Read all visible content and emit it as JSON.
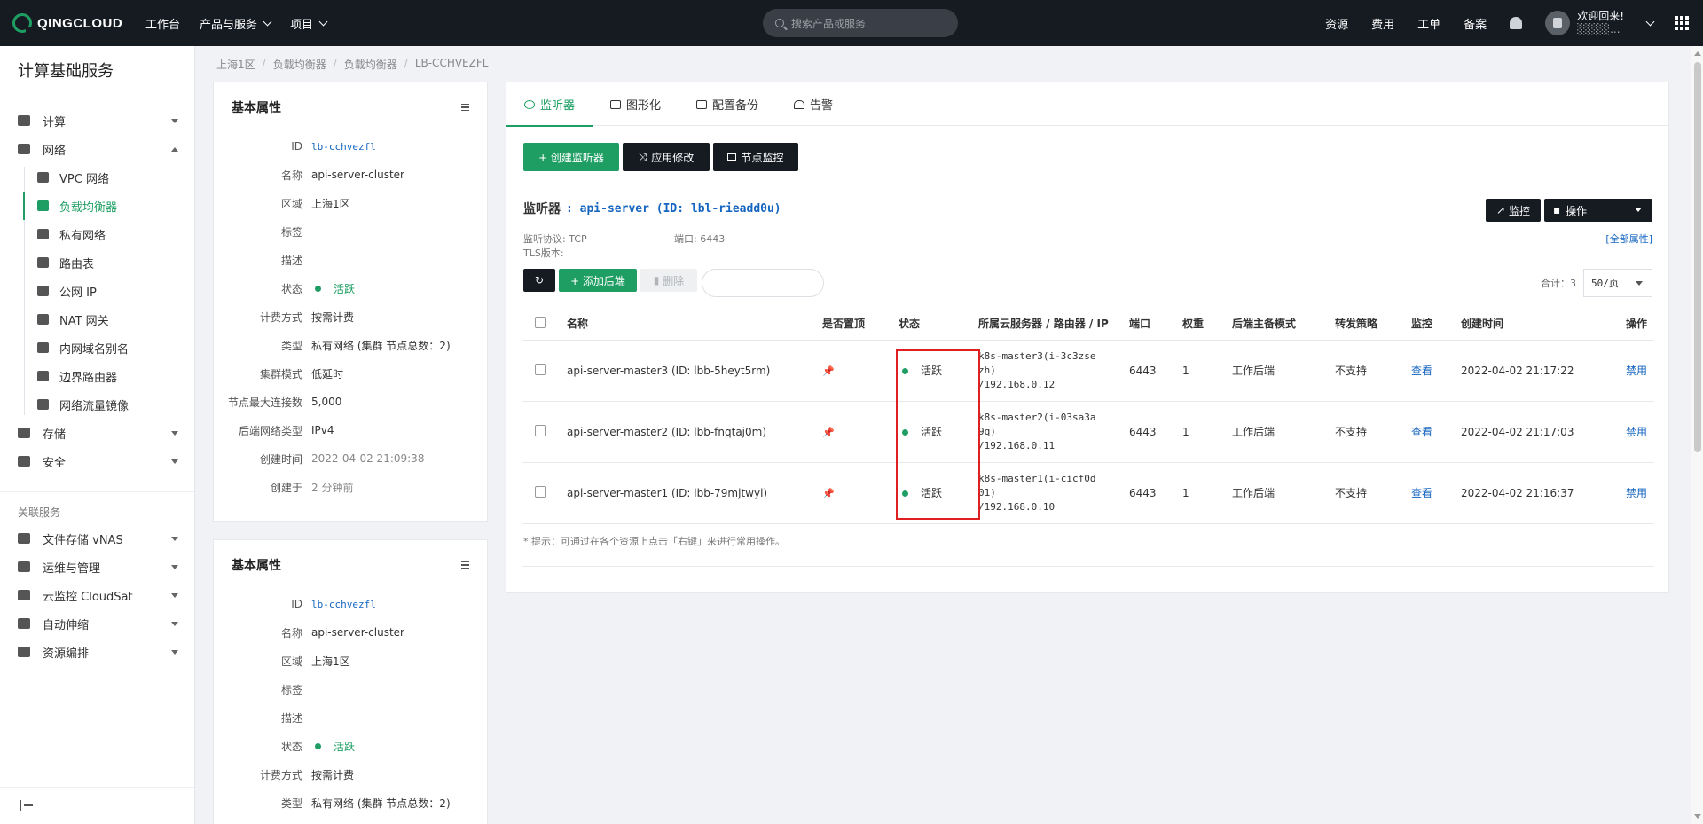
{
  "topbar": {
    "logo": "QINGCLOUD",
    "nav": [
      "工作台",
      "产品与服务",
      "项目"
    ],
    "search_placeholder": "搜索产品或服务",
    "right_items": [
      "资源",
      "费用",
      "工单",
      "备案"
    ],
    "welcome": "欢迎回来!",
    "welcome_sub": "░░░░..."
  },
  "sidebar": {
    "title": "计算基础服务",
    "groups": [
      {
        "label": "计算",
        "icon": "chip-icon"
      },
      {
        "label": "网络",
        "icon": "network-icon"
      }
    ],
    "network_items": [
      {
        "label": "VPC 网络",
        "icon": "vpc-icon"
      },
      {
        "label": "负载均衡器",
        "icon": "load-balancer-icon",
        "active": true
      },
      {
        "label": "私有网络",
        "icon": "wifi-icon"
      },
      {
        "label": "路由表",
        "icon": "route-table-icon"
      },
      {
        "label": "公网 IP",
        "icon": "public-ip-icon"
      },
      {
        "label": "NAT 网关",
        "icon": "nat-gateway-icon"
      },
      {
        "label": "内网域名别名",
        "icon": "dns-alias-icon"
      },
      {
        "label": "边界路由器",
        "icon": "border-router-icon"
      },
      {
        "label": "网络流量镜像",
        "icon": "traffic-mirror-icon"
      }
    ],
    "groups2": [
      {
        "label": "存储",
        "icon": "storage-icon"
      },
      {
        "label": "安全",
        "icon": "shield-icon"
      }
    ],
    "related_label": "关联服务",
    "related": [
      {
        "label": "文件存储 vNAS",
        "icon": "folder-icon"
      },
      {
        "label": "运维与管理",
        "icon": "ops-icon"
      },
      {
        "label": "云监控 CloudSat",
        "icon": "monitor-icon"
      },
      {
        "label": "自动伸缩",
        "icon": "autoscale-icon"
      },
      {
        "label": "资源编排",
        "icon": "orchestration-icon"
      }
    ]
  },
  "breadcrumb": [
    "上海1区",
    "负载均衡器",
    "负载均衡器",
    "LB-CCHVEZFL"
  ],
  "props_panel": {
    "title": "基本属性",
    "rows": [
      {
        "k": "ID",
        "v": "lb-cchvezfl",
        "style": "mono"
      },
      {
        "k": "名称",
        "v": "api-server-cluster"
      },
      {
        "k": "区域",
        "v": "上海1区"
      },
      {
        "k": "标签",
        "v": ""
      },
      {
        "k": "描述",
        "v": ""
      },
      {
        "k": "状态",
        "v": "活跃",
        "style": "status"
      },
      {
        "k": "计费方式",
        "v": "按需计费"
      },
      {
        "k": "类型",
        "v": "私有网络 (集群 节点总数：2)"
      },
      {
        "k": "集群模式",
        "v": "低延时"
      },
      {
        "k": "节点最大连接数",
        "v": "5,000"
      },
      {
        "k": "后端网络类型",
        "v": "IPv4"
      },
      {
        "k": "创建时间",
        "v": "2022-04-02 21:09:38",
        "style": "gray"
      },
      {
        "k": "创建于",
        "v": "2 分钟前",
        "style": "gray"
      }
    ]
  },
  "tabs": [
    "监听器",
    "图形化",
    "配置备份",
    "告警"
  ],
  "toolbar": {
    "create": "+ 创建监听器",
    "apply": "应用修改",
    "node_monitor": "节点监控"
  },
  "listener": {
    "prefix": "监听器",
    "name": ": api-server (ID: lbl-rieadd0u)",
    "protocol_label": "监听协议: TCP",
    "port_label": "端口: 6443",
    "tls_label": "TLS版本:",
    "monitor_btn": "监控",
    "ops_btn": "操作",
    "all_props": "[全部属性]",
    "add_backend": "+ 添加后端",
    "delete": "删除",
    "total": "合计：3",
    "per_page": "50/页"
  },
  "table": {
    "headers": [
      "名称",
      "是否置顶",
      "状态",
      "所属云服务器 / 路由器 / IP",
      "端口",
      "权重",
      "后端主备模式",
      "转发策略",
      "监控",
      "创建时间",
      "操作"
    ],
    "rows": [
      {
        "name": "api-server-master3 (ID: lbb-5heyt5rm)",
        "status": "活跃",
        "srv1": "k8s-master3(i-3c3zse",
        "srv2": "zh)",
        "srv3": "/192.168.0.12",
        "port": "6443",
        "weight": "1",
        "mode": "工作后端",
        "policy": "不支持",
        "monitor": "查看",
        "created": "2022-04-02 21:17:22",
        "op": "禁用"
      },
      {
        "name": "api-server-master2 (ID: lbb-fnqtaj0m)",
        "status": "活跃",
        "srv1": "k8s-master2(i-03sa3a",
        "srv2": "9q)",
        "srv3": "/192.168.0.11",
        "port": "6443",
        "weight": "1",
        "mode": "工作后端",
        "policy": "不支持",
        "monitor": "查看",
        "created": "2022-04-02 21:17:03",
        "op": "禁用"
      },
      {
        "name": "api-server-master1 (ID: lbb-79mjtwyl)",
        "status": "活跃",
        "srv1": "k8s-master1(i-cicf0d",
        "srv2": "01)",
        "srv3": "/192.168.0.10",
        "port": "6443",
        "weight": "1",
        "mode": "工作后端",
        "policy": "不支持",
        "monitor": "查看",
        "created": "2022-04-02 21:16:37",
        "op": "禁用"
      }
    ]
  },
  "hint": "* 提示：可通过在各个资源上点击「右键」来进行常用操作。",
  "colors": {
    "accent": "#1e9e63",
    "topbar": "#161b22",
    "link": "#1565c0",
    "highlight": "#e02020"
  }
}
